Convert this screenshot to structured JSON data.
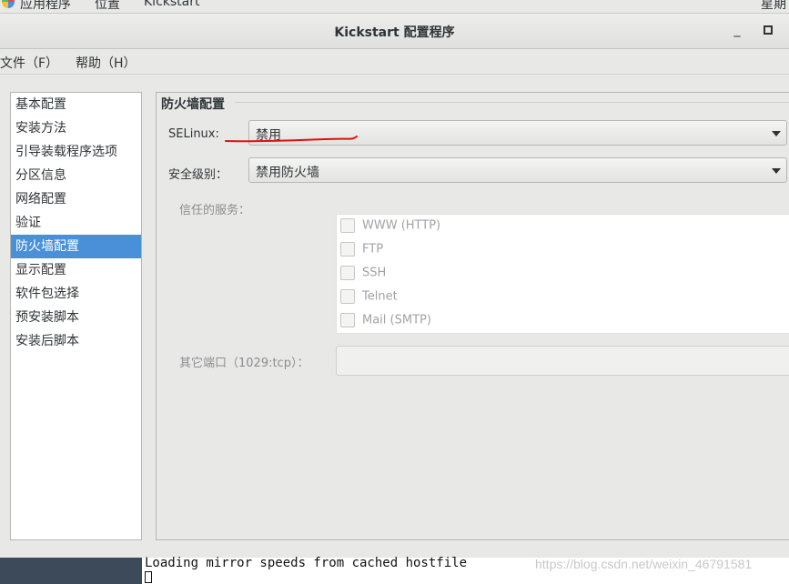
{
  "top_panel": {
    "applications": "应用程序",
    "places": "位置",
    "app_name": "Kickstart",
    "clock_partial": "星期"
  },
  "window": {
    "title": "Kickstart 配置程序",
    "minimize_glyph": "_",
    "maximize_glyph": "▫"
  },
  "menubar": {
    "file": "文件（F）",
    "help": "帮助（H）"
  },
  "sidebar": {
    "items": [
      {
        "label": "基本配置"
      },
      {
        "label": "安装方法"
      },
      {
        "label": "引导装载程序选项"
      },
      {
        "label": "分区信息"
      },
      {
        "label": "网络配置"
      },
      {
        "label": "验证"
      },
      {
        "label": "防火墙配置"
      },
      {
        "label": "显示配置"
      },
      {
        "label": "软件包选择"
      },
      {
        "label": "预安装脚本"
      },
      {
        "label": "安装后脚本"
      }
    ],
    "selected": "防火墙配置"
  },
  "firewall": {
    "section_title": "防火墙配置",
    "selinux_label": "SELinux:",
    "selinux_value": "禁用",
    "security_level_label": "安全级别：",
    "security_level_value": "禁用防火墙",
    "trusted_services_label": "信任的服务：",
    "services": [
      {
        "label": "WWW (HTTP)",
        "checked": false
      },
      {
        "label": "FTP",
        "checked": false
      },
      {
        "label": "SSH",
        "checked": false
      },
      {
        "label": "Telnet",
        "checked": false
      },
      {
        "label": "Mail (SMTP)",
        "checked": false
      }
    ],
    "other_ports_label": "其它端口（1029:tcp）：",
    "other_ports_value": ""
  },
  "terminal": {
    "line": "Loading mirror speeds from cached hostfile"
  },
  "watermark": "https://blog.csdn.net/weixin_46791581",
  "colors": {
    "selection": "#4a90d9",
    "annotation_red": "#e01010"
  }
}
